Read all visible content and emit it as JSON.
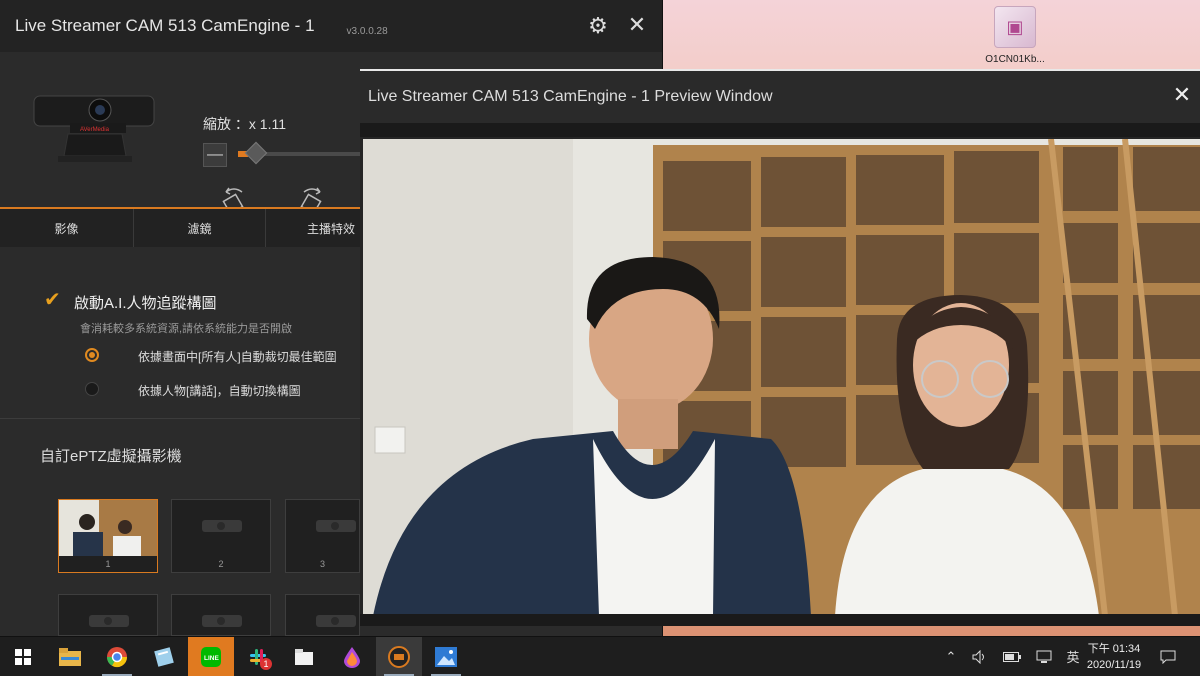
{
  "main_window": {
    "title": "Live Streamer CAM 513 CamEngine - 1",
    "version": "v3.0.0.28",
    "zoom": {
      "label": "縮放 ：x 1.11",
      "value": 1.11
    },
    "tabs": [
      "影像",
      "濾鏡",
      "主播特效"
    ],
    "ai_tracking": {
      "title": "啟動A.I.人物追蹤構圖",
      "subtitle": "會消耗較多系統資源,請依系統能力是否開啟",
      "option1": "依據畫面中[所有人]自動裁切最佳範圍",
      "option2": "依據人物[講話]，自動切換構圖",
      "selected": "option1"
    },
    "eptz": {
      "title": "自訂ePTZ虛擬攝影機",
      "slots": [
        "1",
        "2",
        "3"
      ]
    }
  },
  "preview_window": {
    "title": "Live Streamer CAM 513 CamEngine - 1 Preview Window"
  },
  "desktop": {
    "icon_label": "O1CN01Kb..."
  },
  "taskbar": {
    "input_method": "英",
    "time": "下午 01:34",
    "date": "2020/11/19",
    "notification_badge": "1"
  },
  "colors": {
    "accent": "#e07a20",
    "window_bg": "#2b2b2b"
  }
}
